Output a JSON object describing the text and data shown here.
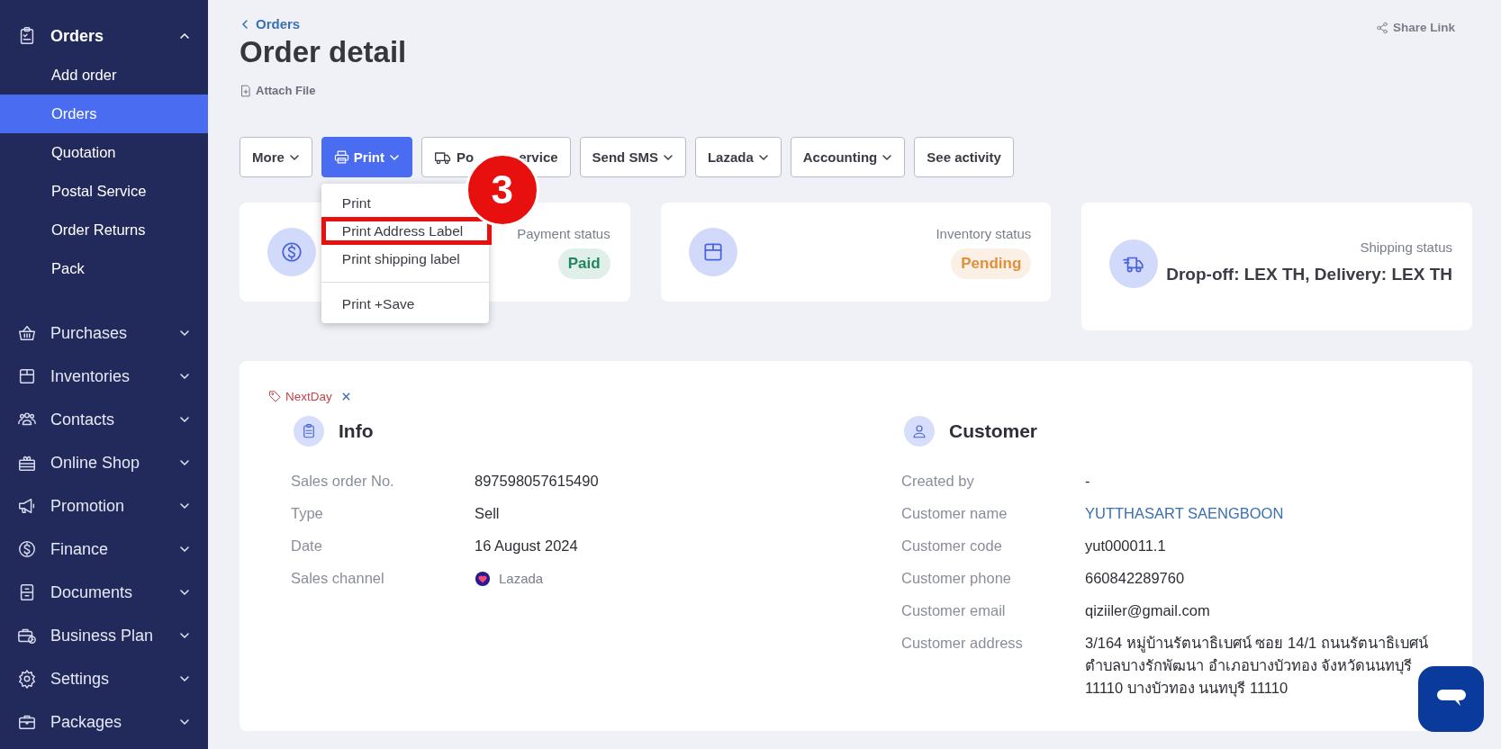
{
  "sidebar": {
    "groups": [
      {
        "label": "Orders",
        "expanded": true,
        "children": [
          {
            "label": "Add order",
            "selected": false
          },
          {
            "label": "Orders",
            "selected": true
          },
          {
            "label": "Quotation",
            "selected": false
          },
          {
            "label": "Postal Service",
            "selected": false
          },
          {
            "label": "Order Returns",
            "selected": false
          },
          {
            "label": "Pack",
            "selected": false
          }
        ]
      },
      {
        "label": "Purchases",
        "expanded": false
      },
      {
        "label": "Inventories",
        "expanded": false
      },
      {
        "label": "Contacts",
        "expanded": false
      },
      {
        "label": "Online Shop",
        "expanded": false
      },
      {
        "label": "Promotion",
        "expanded": false
      },
      {
        "label": "Finance",
        "expanded": false
      },
      {
        "label": "Documents",
        "expanded": false
      },
      {
        "label": "Business Plan",
        "expanded": false
      },
      {
        "label": "Settings",
        "expanded": false
      },
      {
        "label": "Packages",
        "expanded": false
      }
    ]
  },
  "breadcrumb": "Orders",
  "title": "Order detail",
  "attach_file": "Attach File",
  "share_link": "Share Link",
  "toolbar": [
    {
      "kind": "dropdown",
      "label": "More",
      "active": false
    },
    {
      "kind": "dropdown",
      "label": "Print",
      "active": true
    },
    {
      "kind": "covered",
      "label_parts": [
        "Po",
        "ervice"
      ],
      "active": false
    },
    {
      "kind": "dropdown",
      "label": "Send SMS",
      "active": false
    },
    {
      "kind": "dropdown",
      "label": "Lazada",
      "active": false
    },
    {
      "kind": "dropdown",
      "label": "Accounting",
      "active": false
    },
    {
      "kind": "plain",
      "label": "See activity",
      "active": false
    }
  ],
  "print_menu": [
    {
      "label": "Print",
      "highlighted": false,
      "separated": false
    },
    {
      "label": "Print Address Label",
      "highlighted": true,
      "separated": false
    },
    {
      "label": "Print shipping label",
      "highlighted": false,
      "separated": false
    },
    {
      "label": "Print +Save",
      "highlighted": false,
      "separated": true
    }
  ],
  "step_badge": "3",
  "status_cards": [
    {
      "kind": "badge",
      "label": "Payment status",
      "value": "Paid",
      "color": "#21865f"
    },
    {
      "kind": "badge",
      "label": "Inventory status",
      "value": "Pending",
      "color": "#e0903a"
    },
    {
      "kind": "text",
      "label": "Shipping status",
      "value": "Drop-off: LEX TH, Delivery: LEX TH"
    }
  ],
  "tag": {
    "label": "NextDay"
  },
  "info": {
    "title": "Info",
    "fields": [
      {
        "kind": "text",
        "label": "Sales order No.",
        "value": "897598057615490"
      },
      {
        "kind": "text",
        "label": "Type",
        "value": "Sell"
      },
      {
        "kind": "text",
        "label": "Date",
        "value": "16 August 2024"
      },
      {
        "kind": "channel",
        "label": "Sales channel",
        "value": "Lazada"
      }
    ]
  },
  "customer": {
    "title": "Customer",
    "fields": [
      {
        "kind": "text",
        "label": "Created by",
        "value": "-"
      },
      {
        "kind": "link",
        "label": "Customer name",
        "value": "YUTTHASART SAENGBOON"
      },
      {
        "kind": "text",
        "label": "Customer code",
        "value": "yut000011.1"
      },
      {
        "kind": "text",
        "label": "Customer phone",
        "value": "660842289760"
      },
      {
        "kind": "text",
        "label": "Customer email",
        "value": "qiziiler@gmail.com"
      },
      {
        "kind": "text",
        "label": "Customer address",
        "value": "3/164 หมู่บ้านรัตนาธิเบศน์ ซอย 14/1 ถนนรัตนาธิเบศน์ ตำบลบางรักพัฒนา อำเภอบางบัวทอง จังหวัดนนทบุรี 11110 บางบัวทอง นนทบุรี 11110"
      }
    ]
  }
}
